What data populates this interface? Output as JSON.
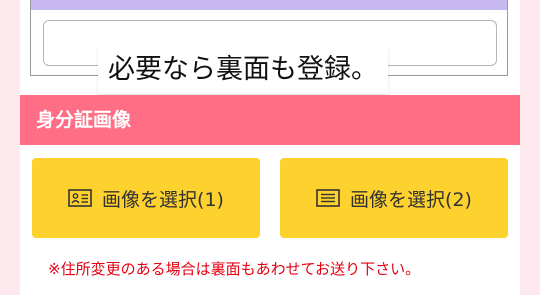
{
  "upload": {
    "caption": "必要なら裏面も登録。"
  },
  "section": {
    "title": "身分証画像"
  },
  "buttons": [
    {
      "label": "画像を選択(1)",
      "icon": "id-card-icon"
    },
    {
      "label": "画像を選択(2)",
      "icon": "document-icon"
    }
  ],
  "notice": "※住所変更のある場合は裏面もあわせてお送り下さい。",
  "colors": {
    "page_bg": "#fde8ee",
    "header_bg": "#ff6e85",
    "button_bg": "#fdd12e",
    "notice_text": "#e60012",
    "frame_band": "#c8b8f2"
  }
}
